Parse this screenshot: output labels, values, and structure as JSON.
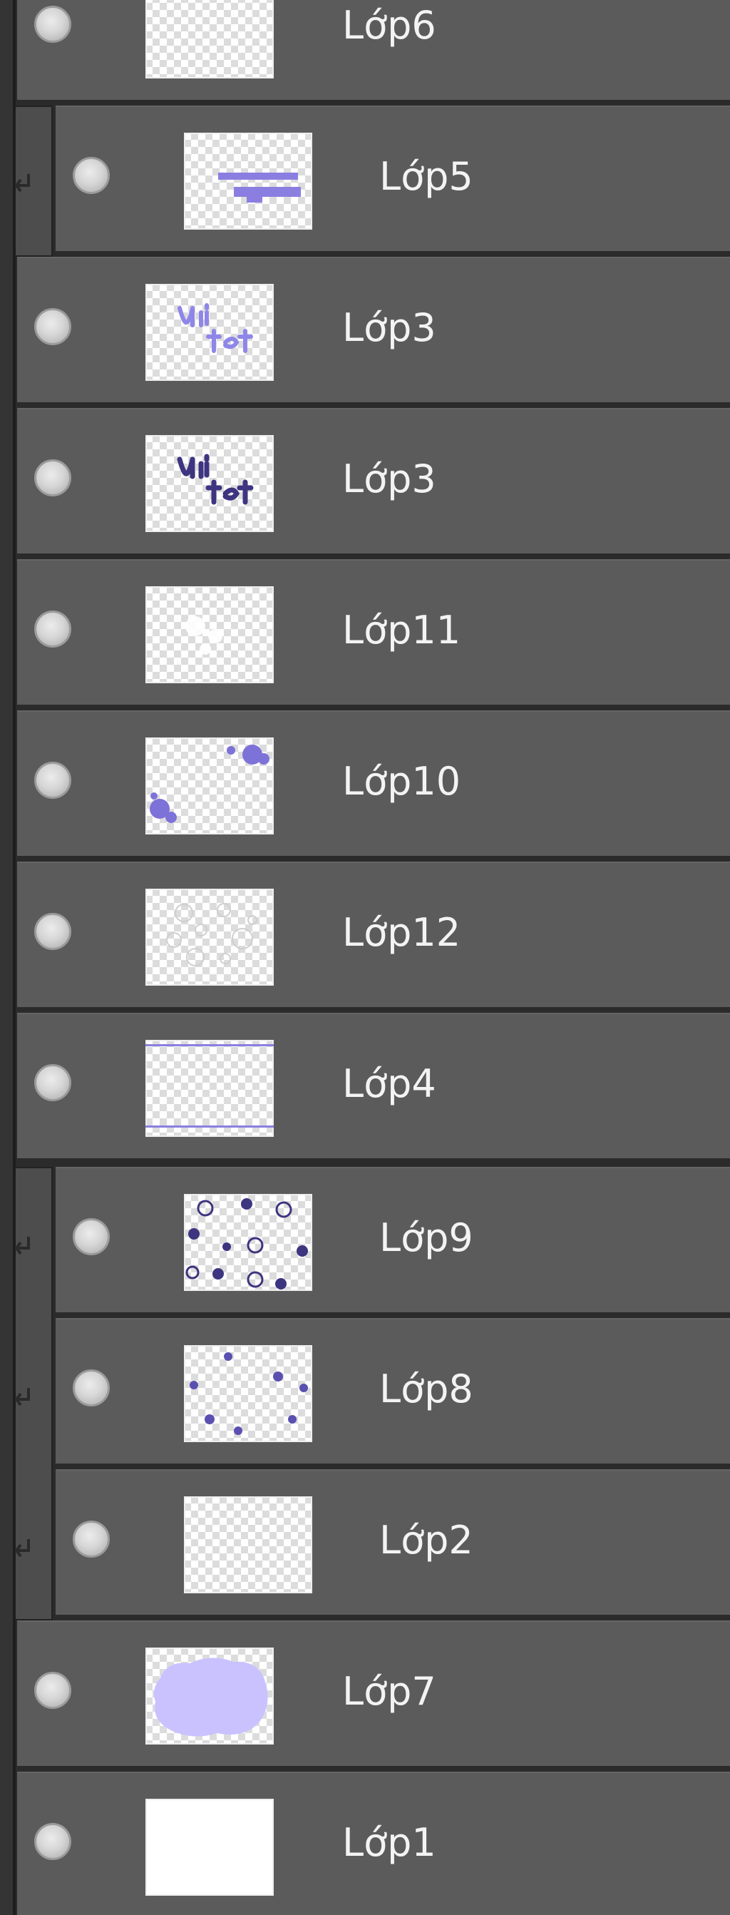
{
  "layers_panel": {
    "layers": [
      {
        "name": "Lớp6",
        "clipped": false,
        "thumbnail": "transparent-empty"
      },
      {
        "name": "Lớp5",
        "clipped": true,
        "thumbnail": "purple-bars"
      },
      {
        "name": "Lớp3",
        "clipped": false,
        "thumbnail": "light-purple-lettering"
      },
      {
        "name": "Lớp3",
        "clipped": false,
        "thumbnail": "dark-purple-lettering"
      },
      {
        "name": "Lớp11",
        "clipped": false,
        "thumbnail": "white-sparkles"
      },
      {
        "name": "Lớp10",
        "clipped": false,
        "thumbnail": "purple-fruits"
      },
      {
        "name": "Lớp12",
        "clipped": false,
        "thumbnail": "white-circle-outlines"
      },
      {
        "name": "Lớp4",
        "clipped": false,
        "thumbnail": "purple-lines"
      },
      {
        "name": "Lớp9",
        "clipped": true,
        "thumbnail": "purple-dots-pattern"
      },
      {
        "name": "Lớp8",
        "clipped": true,
        "thumbnail": "purple-flower-pattern"
      },
      {
        "name": "Lớp2",
        "clipped": true,
        "thumbnail": "transparent-empty"
      },
      {
        "name": "Lớp7",
        "clipped": false,
        "thumbnail": "lavender-blob"
      },
      {
        "name": "Lớp1",
        "clipped": false,
        "thumbnail": "white-fill"
      }
    ]
  },
  "icons": {
    "visibility": "eye-toggle-icon",
    "clipping": "clipping-arrow-icon"
  },
  "colors": {
    "row_bg": "#5b5b5b",
    "panel_bg": "#2b2b2b",
    "text": "#f3f3f3",
    "accent_purple": "#8a7fe0",
    "dark_purple": "#3d3580",
    "lavender": "#c9c2ff"
  }
}
